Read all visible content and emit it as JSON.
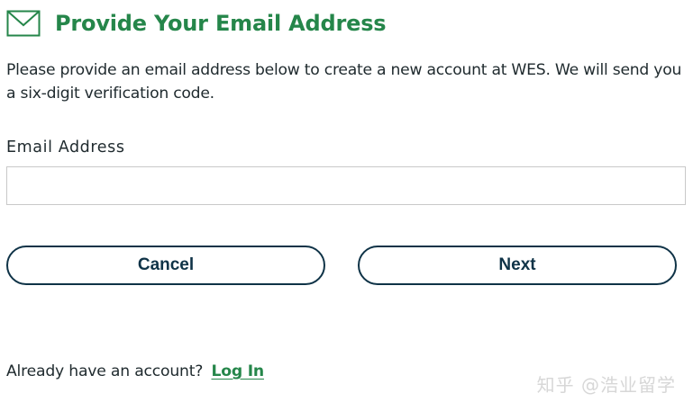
{
  "header": {
    "icon": "mail-icon",
    "title": "Provide Your Email Address"
  },
  "description": "Please provide an email address below to create a new account at WES. We will send you a six-digit verification code.",
  "form": {
    "email_label": "Email Address",
    "email_value": "",
    "email_placeholder": ""
  },
  "buttons": {
    "cancel_label": "Cancel",
    "next_label": "Next"
  },
  "footer": {
    "prompt": "Already have an account?",
    "login_label": "Log In"
  },
  "watermark": "知乎 @浩业留学",
  "colors": {
    "heading_green": "#25864a",
    "button_navy": "#0f3347",
    "input_border": "#c9c9c9",
    "text": "#1f2a2e"
  }
}
